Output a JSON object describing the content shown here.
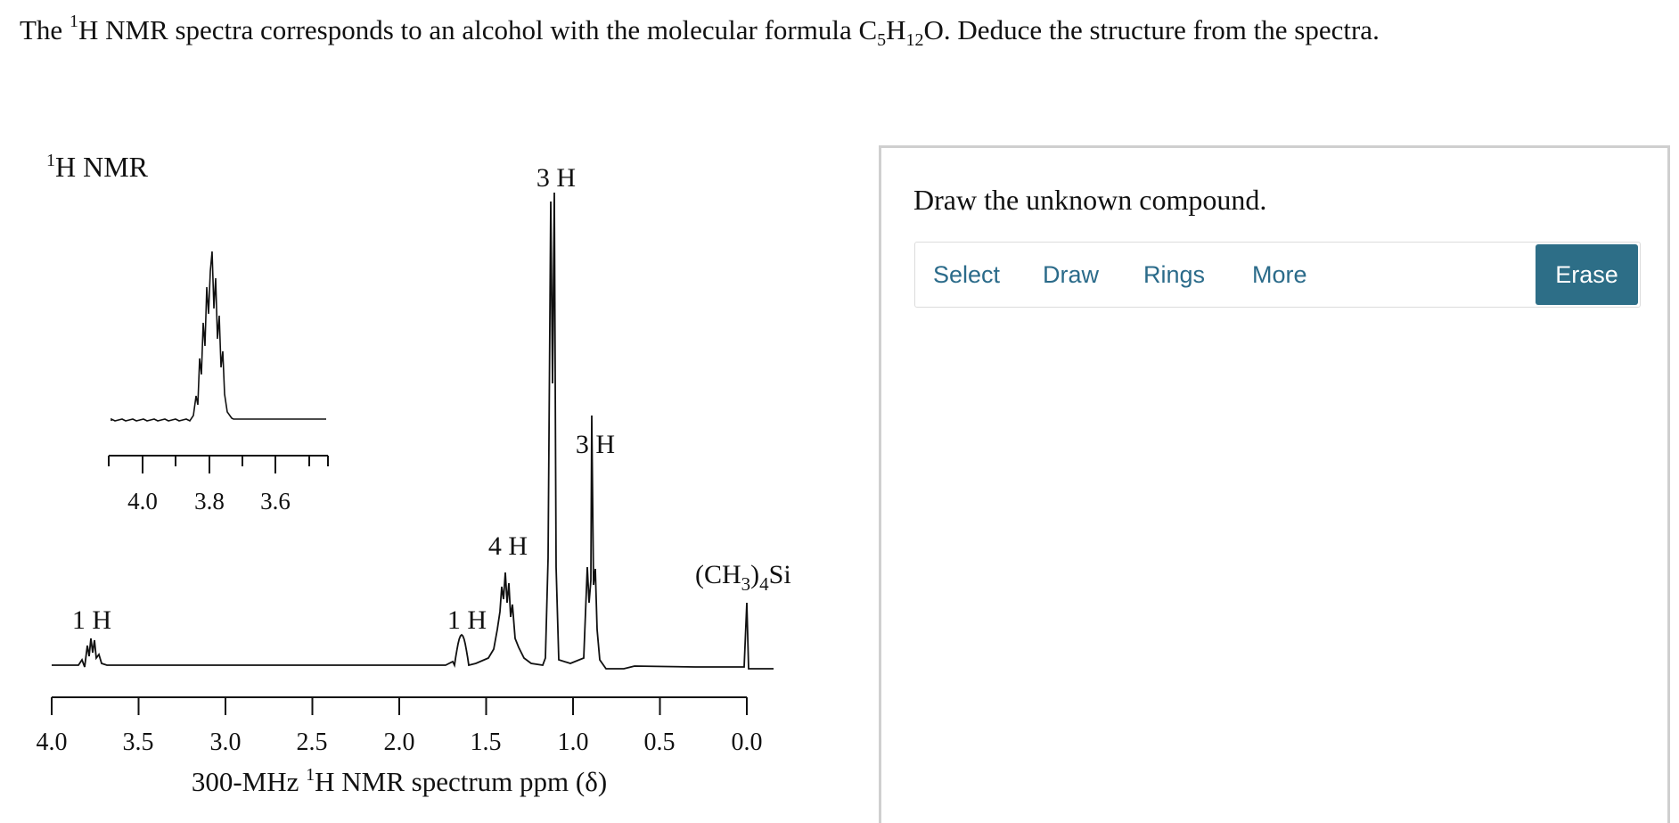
{
  "question": {
    "p1": "The ",
    "sup": "1",
    "p2": "H NMR spectra corresponds to an alcohol with the molecular formula C",
    "sub1": "5",
    "p3": "H",
    "sub2": "12",
    "p4": "O. Deduce the structure from the spectra."
  },
  "spectrum": {
    "title_sup": "1",
    "title": "H NMR",
    "xlabel_pre": "300-MHz ",
    "xlabel_sup": "1",
    "xlabel_post": "H NMR spectrum ppm (δ)",
    "axis_ticks": [
      "4.0",
      "3.5",
      "3.0",
      "2.5",
      "2.0",
      "1.5",
      "1.0",
      "0.5",
      "0.0"
    ],
    "inset_ticks": [
      "4.0",
      "3.8",
      "3.6"
    ],
    "peak_labels": {
      "oh": "1 H",
      "h_37": "1 H",
      "h_14": "4 H",
      "h_112": "3 H",
      "h_09": "3 H"
    },
    "tms": "(CH3)4Si",
    "tms_base": "(CH",
    "tms_sub": "3",
    "tms_mid": ")",
    "tms_sub2": "4",
    "tms_end": "Si"
  },
  "chart_data": {
    "type": "line",
    "title": "1H NMR",
    "xlabel": "300-MHz 1H NMR spectrum ppm (δ)",
    "xlim": [
      4.0,
      0.0
    ],
    "x_ticks": [
      4.0,
      3.5,
      3.0,
      2.5,
      2.0,
      1.5,
      1.0,
      0.5,
      0.0
    ],
    "peaks": [
      {
        "shift": 3.7,
        "integration": "1 H"
      },
      {
        "shift": 1.6,
        "integration": "1 H"
      },
      {
        "shift": 1.4,
        "integration": "4 H"
      },
      {
        "shift": 1.12,
        "integration": "3 H"
      },
      {
        "shift": 0.9,
        "integration": "3 H"
      },
      {
        "shift": 0.0,
        "integration": "(CH3)4Si"
      }
    ],
    "inset": {
      "xlim": [
        4.1,
        3.5
      ],
      "x_ticks": [
        4.0,
        3.8,
        3.6
      ],
      "peak_shift": 3.78
    }
  },
  "editor": {
    "prompt": "Draw the unknown compound.",
    "tools": {
      "select": "Select",
      "draw": "Draw",
      "rings": "Rings",
      "more": "More"
    },
    "erase": "Erase",
    "colors": {
      "accent": "#2d6e87",
      "tool_text": "#2b6b8a",
      "border": "#cfcfcf"
    }
  }
}
